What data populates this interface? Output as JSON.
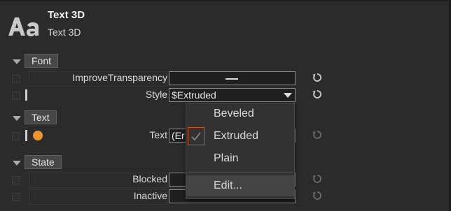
{
  "header": {
    "title": "Text 3D",
    "subtitle": "Text 3D",
    "logo_text": "Aa"
  },
  "sections": {
    "font": "Font",
    "text": "Text",
    "state": "State"
  },
  "properties": {
    "improve_transparency": {
      "label": "ImproveTransparency"
    },
    "style": {
      "label": "Style",
      "value": "$Extruded"
    },
    "text": {
      "label": "Text",
      "value": "(Er"
    },
    "blocked": {
      "label": "Blocked"
    },
    "inactive": {
      "label": "Inactive"
    }
  },
  "dropdown": {
    "items": [
      "Beveled",
      "Extruded",
      "Plain",
      "Edit..."
    ],
    "selected": "Extruded"
  },
  "colors": {
    "accent": "#f0932a",
    "selection_border": "#d9531e",
    "background": "#2b2b2b"
  },
  "icons": [
    "text-3d-icon",
    "reset-icon",
    "dropdown-arrow-icon",
    "check-icon"
  ]
}
